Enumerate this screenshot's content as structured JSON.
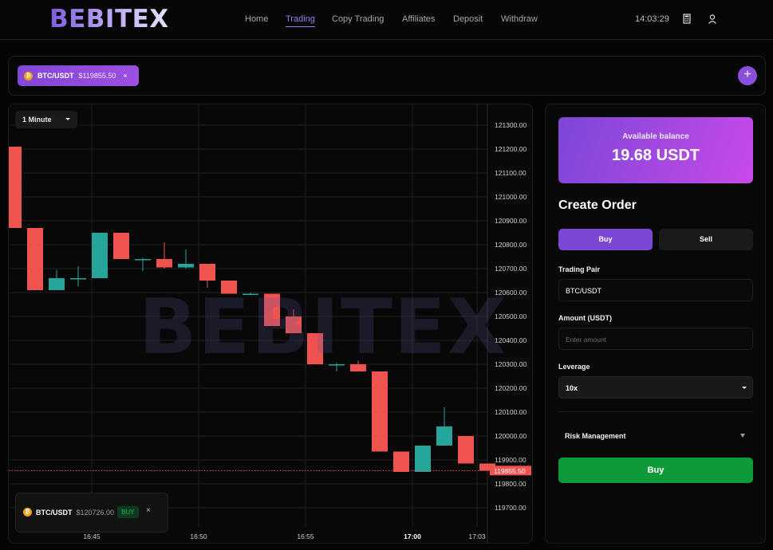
{
  "header": {
    "logo": "BEBITEX",
    "nav": [
      "Home",
      "Trading",
      "Copy Trading",
      "Affiliates",
      "Deposit",
      "Withdraw"
    ],
    "active_nav": "Trading",
    "clock": "14:03:29",
    "icons": [
      "calculator-icon",
      "user-icon"
    ]
  },
  "pair_strip": {
    "tab": {
      "symbol": "BTC/USDT",
      "price": "$119855.50",
      "close": "×",
      "coin_icon": "bitcoin-icon"
    },
    "add_label": "+"
  },
  "chart": {
    "timeframe": "1 Minute",
    "watermark": "BEBITEX",
    "current_price_label": "119855.50",
    "position_card": {
      "symbol": "BTC/USDT",
      "price": "$120726.00",
      "side": "BUY",
      "close": "×"
    }
  },
  "chart_data": {
    "type": "candlestick",
    "ylim": [
      119700,
      121300
    ],
    "y_ticks": [
      "121300.00",
      "121200.00",
      "121100.00",
      "121000.00",
      "120900.00",
      "120800.00",
      "120700.00",
      "120600.00",
      "120500.00",
      "120400.00",
      "120300.00",
      "120200.00",
      "120100.00",
      "120000.00",
      "119900.00",
      "119800.00",
      "119700.00"
    ],
    "x_ticks": [
      "16:45",
      "16:50",
      "16:55",
      "17:00",
      "17:03"
    ],
    "current_price": 119855.5,
    "colors": {
      "up": "#26a69a",
      "down": "#ef5350"
    },
    "candles": [
      {
        "o": 121210,
        "h": 121210,
        "l": 120870,
        "c": 120870
      },
      {
        "o": 120870,
        "h": 120870,
        "l": 120610,
        "c": 120610
      },
      {
        "o": 120610,
        "h": 120695,
        "l": 120610,
        "c": 120660
      },
      {
        "o": 120660,
        "h": 120710,
        "l": 120625,
        "c": 120660
      },
      {
        "o": 120660,
        "h": 120850,
        "l": 120660,
        "c": 120850
      },
      {
        "o": 120850,
        "h": 120850,
        "l": 120740,
        "c": 120740
      },
      {
        "o": 120740,
        "h": 120745,
        "l": 120690,
        "c": 120740
      },
      {
        "o": 120740,
        "h": 120810,
        "l": 120700,
        "c": 120705
      },
      {
        "o": 120705,
        "h": 120780,
        "l": 120700,
        "c": 120720
      },
      {
        "o": 120720,
        "h": 120720,
        "l": 120620,
        "c": 120650
      },
      {
        "o": 120650,
        "h": 120650,
        "l": 120595,
        "c": 120595
      },
      {
        "o": 120595,
        "h": 120600,
        "l": 120590,
        "c": 120595
      },
      {
        "o": 120595,
        "h": 120595,
        "l": 120460,
        "c": 120460
      },
      {
        "o": 120500,
        "h": 120530,
        "l": 120430,
        "c": 120430
      },
      {
        "o": 120430,
        "h": 120430,
        "l": 120300,
        "c": 120300
      },
      {
        "o": 120295,
        "h": 120305,
        "l": 120270,
        "c": 120300
      },
      {
        "o": 120300,
        "h": 120315,
        "l": 120270,
        "c": 120270
      },
      {
        "o": 120270,
        "h": 120270,
        "l": 119935,
        "c": 119935
      },
      {
        "o": 119935,
        "h": 119935,
        "l": 119850,
        "c": 119850
      },
      {
        "o": 119850,
        "h": 119960,
        "l": 119850,
        "c": 119960
      },
      {
        "o": 119960,
        "h": 120120,
        "l": 119960,
        "c": 120040
      },
      {
        "o": 120000,
        "h": 120000,
        "l": 119885,
        "c": 119885
      },
      {
        "o": 119885,
        "h": 119885,
        "l": 119855,
        "c": 119855
      }
    ]
  },
  "order_panel": {
    "balance_label": "Available balance",
    "balance_value": "19.68 USDT",
    "title": "Create Order",
    "buy_tab": "Buy",
    "sell_tab": "Sell",
    "pair_label": "Trading Pair",
    "pair_value": "BTC/USDT",
    "amount_label": "Amount (USDT)",
    "amount_placeholder": "Enter amount",
    "leverage_label": "Leverage",
    "leverage_value": "10x",
    "risk_label": "Risk Management",
    "submit_label": "Buy"
  }
}
